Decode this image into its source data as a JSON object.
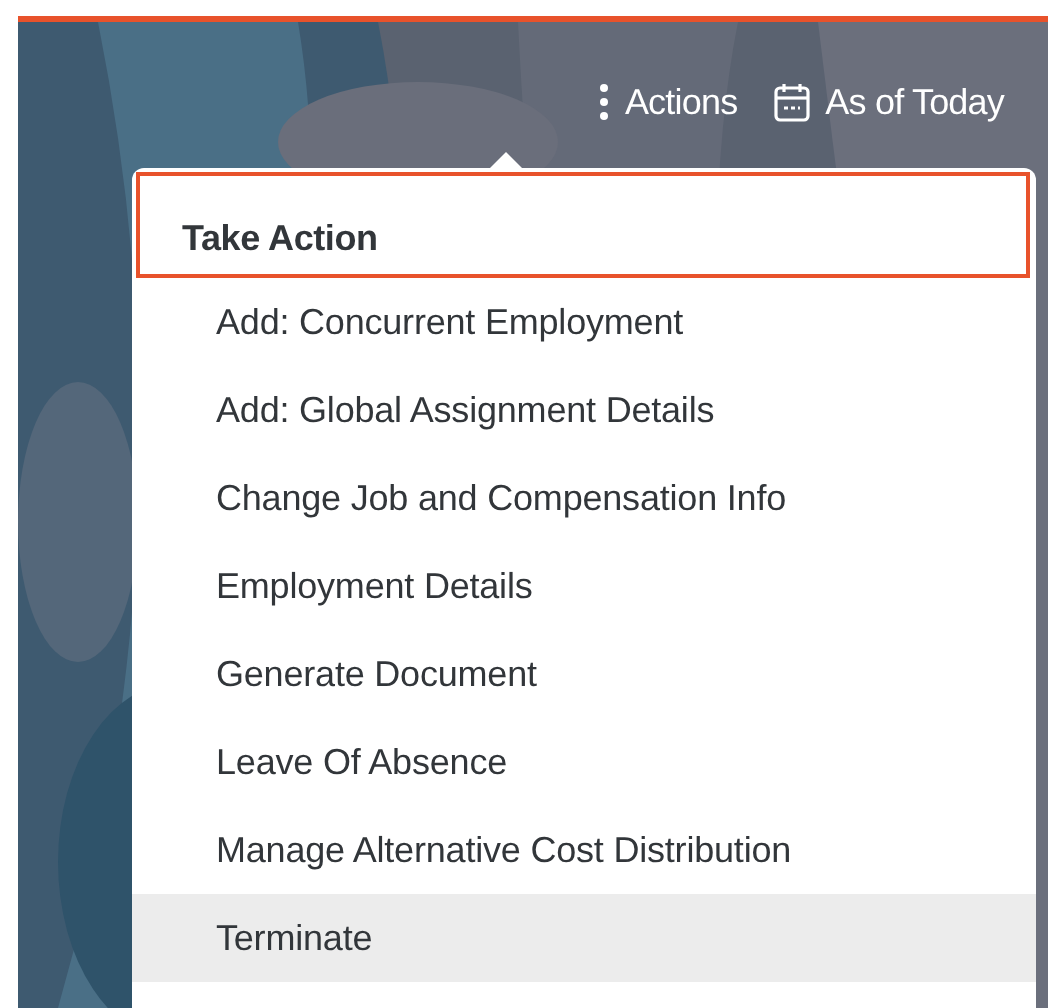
{
  "toolbar": {
    "actions": "Actions",
    "date": "As of Today"
  },
  "menu": {
    "title": "Take Action",
    "items": [
      {
        "label": "Add: Concurrent Employment",
        "selected": false
      },
      {
        "label": "Add: Global Assignment Details",
        "selected": false
      },
      {
        "label": "Change Job and Compensation Info",
        "selected": false
      },
      {
        "label": "Employment Details",
        "selected": false
      },
      {
        "label": "Generate Document",
        "selected": false
      },
      {
        "label": "Leave Of Absence",
        "selected": false
      },
      {
        "label": "Manage Alternative Cost Distribution",
        "selected": false
      },
      {
        "label": "Terminate",
        "selected": true
      }
    ]
  }
}
